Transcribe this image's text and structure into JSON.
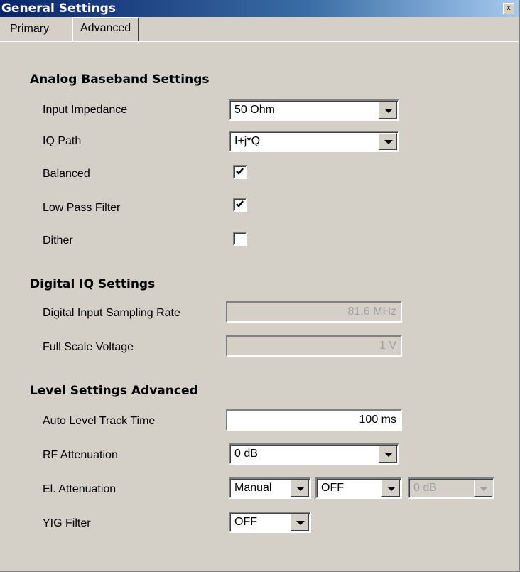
{
  "window": {
    "title": "General Settings",
    "close_symbol": "x"
  },
  "tabs": [
    {
      "label": "Primary"
    },
    {
      "label": "Advanced"
    }
  ],
  "analog": {
    "header": "Analog Baseband Settings",
    "input_impedance": {
      "label": "Input Impedance",
      "value": "50 Ohm"
    },
    "iq_path": {
      "label": "IQ Path",
      "value": "I+j*Q"
    },
    "balanced": {
      "label": "Balanced",
      "checked": true
    },
    "low_pass": {
      "label": "Low Pass Filter",
      "checked": true
    },
    "dither": {
      "label": "Dither",
      "checked": false
    }
  },
  "digital": {
    "header": "Digital IQ Settings",
    "sampling_rate": {
      "label": "Digital Input Sampling Rate",
      "value": "81.6 MHz"
    },
    "full_scale": {
      "label": "Full Scale Voltage",
      "value": "1 V"
    }
  },
  "level": {
    "header": "Level Settings Advanced",
    "track_time": {
      "label": "Auto Level Track Time",
      "value": "100 ms"
    },
    "rf_att": {
      "label": "RF Attenuation",
      "value": "0 dB"
    },
    "el_att": {
      "label": "El. Attenuation",
      "mode": "Manual",
      "state": "OFF",
      "value": "0 dB"
    },
    "yig": {
      "label": "YIG Filter",
      "value": "OFF"
    }
  }
}
